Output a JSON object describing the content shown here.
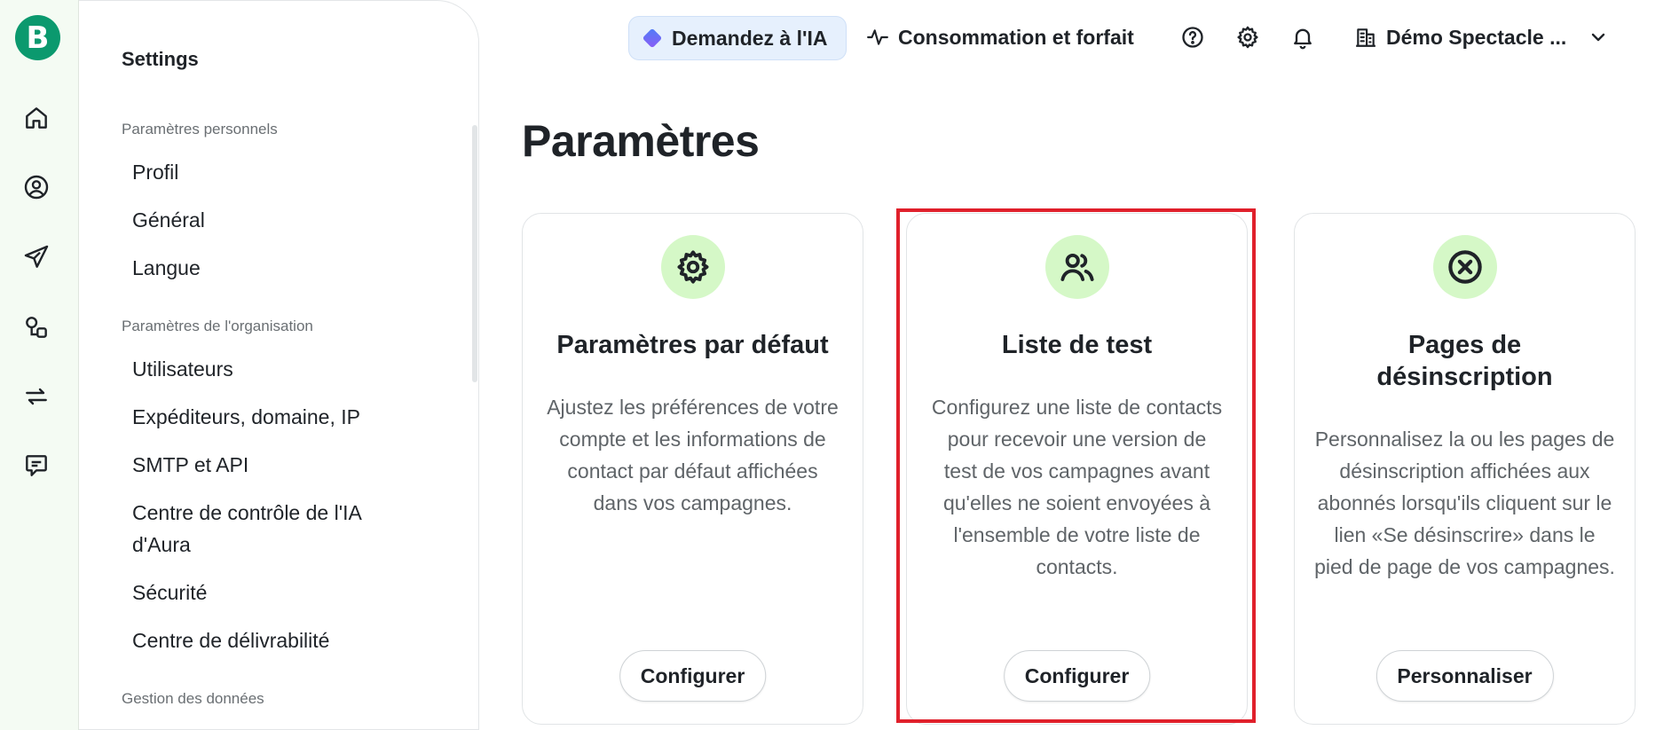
{
  "app": {
    "logo_letter": "B"
  },
  "rail": {
    "icons": [
      "home-icon",
      "contacts-icon",
      "campaigns-icon",
      "automation-icon",
      "transactional-icon",
      "conversations-icon"
    ]
  },
  "topbar": {
    "ask_ai": "Demandez à l'IA",
    "usage": "Consommation et forfait",
    "account": "Démo Spectacle ..."
  },
  "panel": {
    "title": "Settings",
    "groups": [
      {
        "label": "Paramètres personnels",
        "items": [
          "Profil",
          "Général",
          "Langue"
        ]
      },
      {
        "label": "Paramètres de l'organisation",
        "items": [
          "Utilisateurs",
          "Expéditeurs, domaine, IP",
          "SMTP et API",
          "Centre de contrôle de l'IA d'Aura",
          "Sécurité",
          "Centre de délivrabilité"
        ]
      },
      {
        "label": "Gestion des données",
        "items": []
      }
    ]
  },
  "main": {
    "title": "Paramètres",
    "cards": [
      {
        "icon": "gear-icon",
        "title": "Paramètres par défaut",
        "description": "Ajustez les préférences de votre compte et les informations de contact par défaut affichées dans vos campagnes.",
        "button": "Configurer"
      },
      {
        "icon": "users-icon",
        "title": "Liste de test",
        "description": "Configurez une liste de contacts pour recevoir une version de test de vos campagnes avant qu'elles ne soient envoyées à l'ensemble de votre liste de contacts.",
        "button": "Configurer"
      },
      {
        "icon": "x-circle-icon",
        "title": "Pages de désinscription",
        "description": "Personnalisez la ou les pages de désinscription affichées aux abonnés lorsqu'ils cliquent sur le lien «Se désinscrire» dans le pied de page de vos campagnes.",
        "button": "Personnaliser"
      }
    ]
  },
  "colors": {
    "brand": "#0b996e",
    "icon_bg": "#d5f8c7",
    "highlight": "#e0202b",
    "rail_bg": "#f4fbf3"
  }
}
